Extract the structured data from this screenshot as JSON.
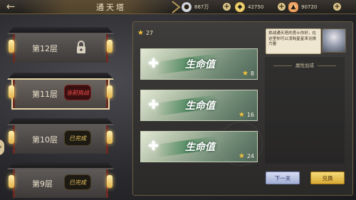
{
  "header": {
    "title": "通天塔",
    "back_icon": "←",
    "currencies": [
      {
        "name": "silver-coin",
        "value": "667万"
      },
      {
        "name": "gold-coin",
        "value": "42750"
      },
      {
        "name": "ingot",
        "value": "90720"
      }
    ]
  },
  "floors": [
    {
      "label": "第12层",
      "status": "locked",
      "status_text": ""
    },
    {
      "label": "第11层",
      "status": "challenge",
      "status_text": "当前挑战"
    },
    {
      "label": "第10层",
      "status": "done",
      "status_text": "已完成"
    },
    {
      "label": "第9层",
      "status": "done",
      "status_text": "已完成"
    }
  ],
  "panel": {
    "stars_total": "27",
    "rewards": [
      {
        "name": "生命值",
        "cost": "8"
      },
      {
        "name": "生命值",
        "cost": "16"
      },
      {
        "name": "生命值",
        "cost": "24"
      }
    ],
    "npc_text": "挑战通天塔的勇士你好，在这里你可以消耗星星来兑换力量",
    "attr_title": "属性加成",
    "next_button": "下一关",
    "exchange_button": "兑换"
  },
  "colors": {
    "accent_gold": "#e9c45a",
    "challenge_red": "#ff5050"
  }
}
